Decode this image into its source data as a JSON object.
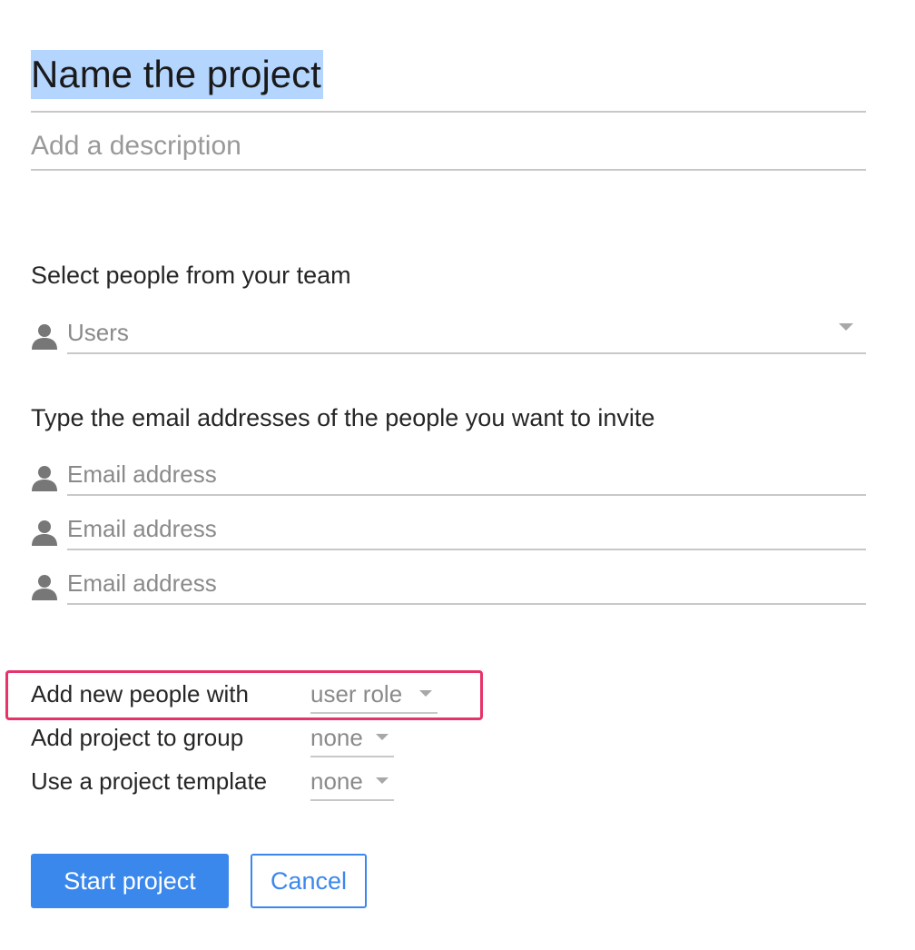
{
  "form": {
    "title_value": "Name the project",
    "description_placeholder": "Add a description"
  },
  "team": {
    "heading": "Select people from your team",
    "users_placeholder": "Users"
  },
  "invite": {
    "heading": "Type the email addresses of the people you want to invite",
    "emails": [
      {
        "placeholder": "Email address",
        "icon": "person-icon"
      },
      {
        "placeholder": "Email address",
        "icon": "person-icon"
      },
      {
        "placeholder": "Email address",
        "icon": "person-icon"
      }
    ]
  },
  "options": {
    "role": {
      "label": "Add new people with",
      "value": "user role"
    },
    "group": {
      "label": "Add project to group",
      "value": "none"
    },
    "template": {
      "label": "Use a project template",
      "value": "none"
    }
  },
  "actions": {
    "start_label": "Start project",
    "cancel_label": "Cancel"
  },
  "colors": {
    "accent": "#3b88ec",
    "highlight_border": "#e6336a",
    "text_selection": "#b4d5fe"
  }
}
